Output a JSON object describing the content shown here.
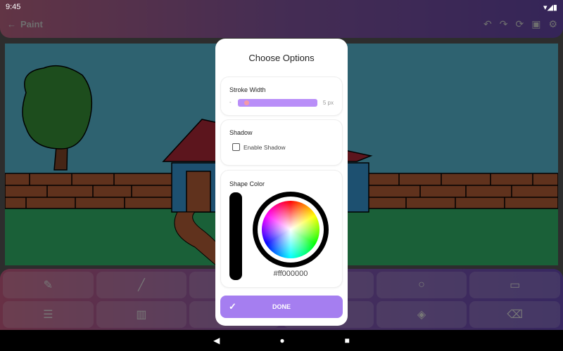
{
  "status": {
    "time": "9:45"
  },
  "appbar": {
    "title": "Paint",
    "actions": [
      "undo-icon",
      "redo-icon",
      "reset-icon",
      "save-icon",
      "gear-icon"
    ]
  },
  "tools": [
    {
      "icon": "brush-icon",
      "glyph": "✎"
    },
    {
      "icon": "line-icon",
      "glyph": "╱"
    },
    {
      "icon": "tool-icon",
      "glyph": ""
    },
    {
      "icon": "tool-icon",
      "glyph": ""
    },
    {
      "icon": "circle-icon",
      "glyph": "○"
    },
    {
      "icon": "rectangle-icon",
      "glyph": "▭"
    },
    {
      "icon": "horizontal-lines-icon",
      "glyph": "☰"
    },
    {
      "icon": "vertical-lines-icon",
      "glyph": "▥"
    },
    {
      "icon": "tool-icon",
      "glyph": ""
    },
    {
      "icon": "tool-icon",
      "glyph": ""
    },
    {
      "icon": "fill-icon",
      "glyph": "◈"
    },
    {
      "icon": "eraser-icon",
      "glyph": "⌫"
    }
  ],
  "dialog": {
    "title": "Choose Options",
    "stroke": {
      "label": "Stroke Width",
      "min_label": "-",
      "value_label": "5 px",
      "value_fraction": 0.08
    },
    "shadow": {
      "label": "Shadow",
      "checkbox_label": "Enable Shadow",
      "checked": false
    },
    "color": {
      "label": "Shape Color",
      "hex": "#ff000000"
    },
    "done_label": "DONE"
  },
  "colors": {
    "accent": "#a57ef0",
    "thumb": "#f49aa8"
  }
}
